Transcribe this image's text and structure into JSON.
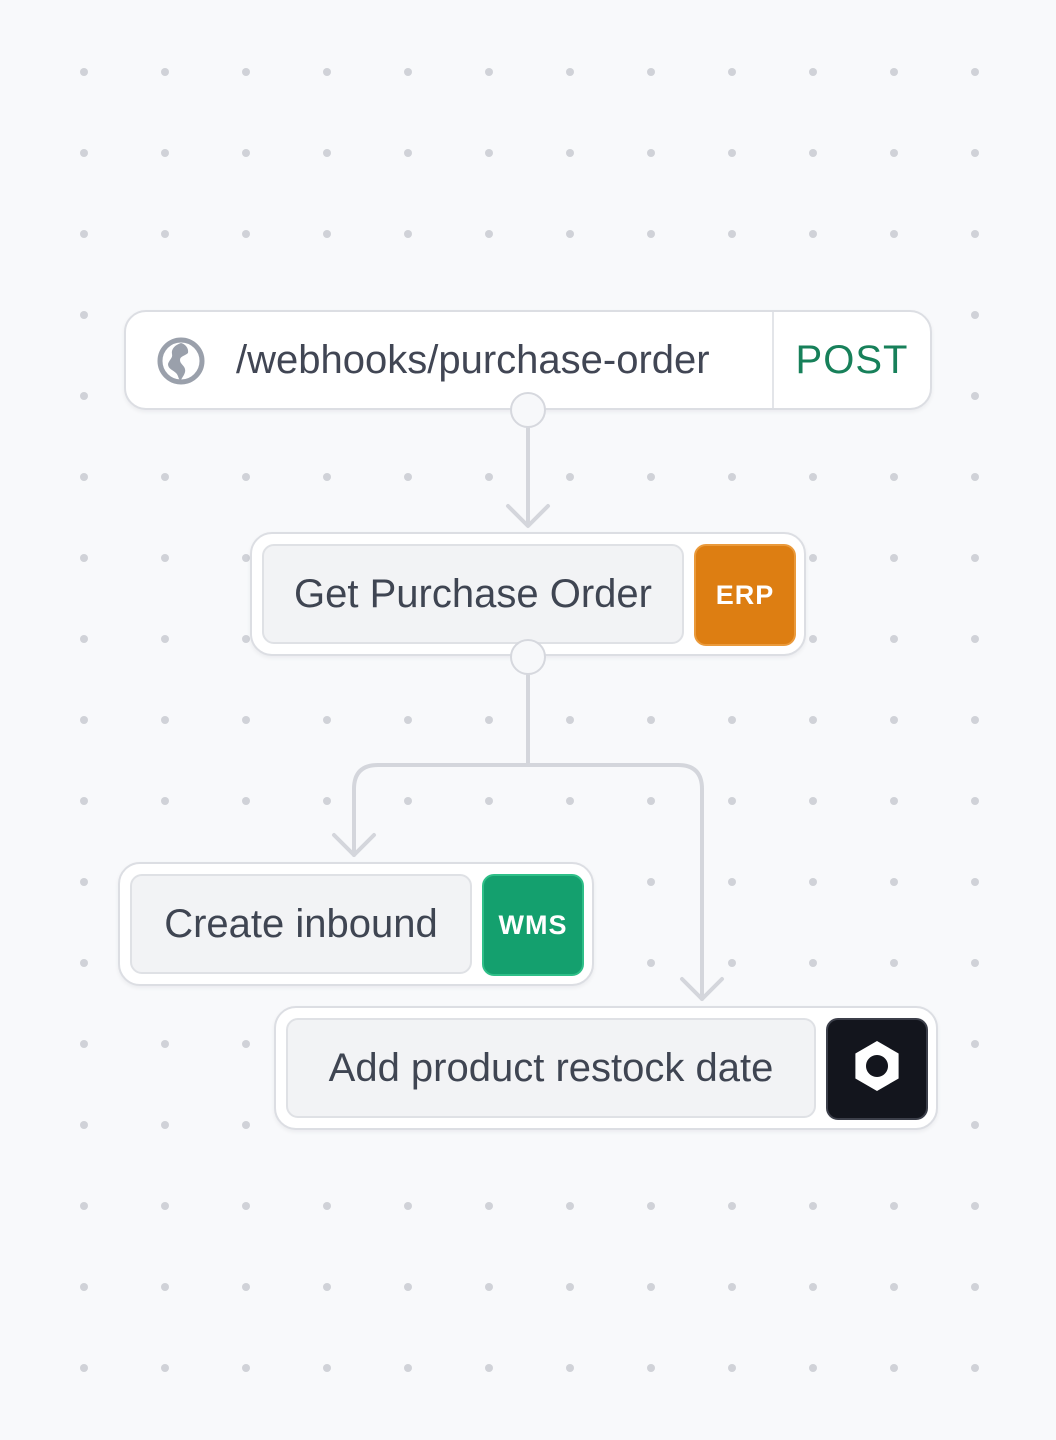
{
  "trigger": {
    "icon": "globe-icon",
    "path": "/webhooks/purchase-order",
    "method": "POST",
    "method_color": "#17805a"
  },
  "steps": [
    {
      "label": "Get Purchase Order",
      "badge": "ERP",
      "badge_color": "#dd7e12"
    },
    {
      "label": "Create inbound",
      "badge": "WMS",
      "badge_color": "#14a06e"
    },
    {
      "label": "Add product restock date",
      "badge_icon": "hexagon-nut-icon",
      "badge_color": "#13151d"
    }
  ],
  "colors": {
    "background": "#f8f9fb",
    "connector": "#d4d6dc",
    "dot": "#d0d2d8"
  }
}
